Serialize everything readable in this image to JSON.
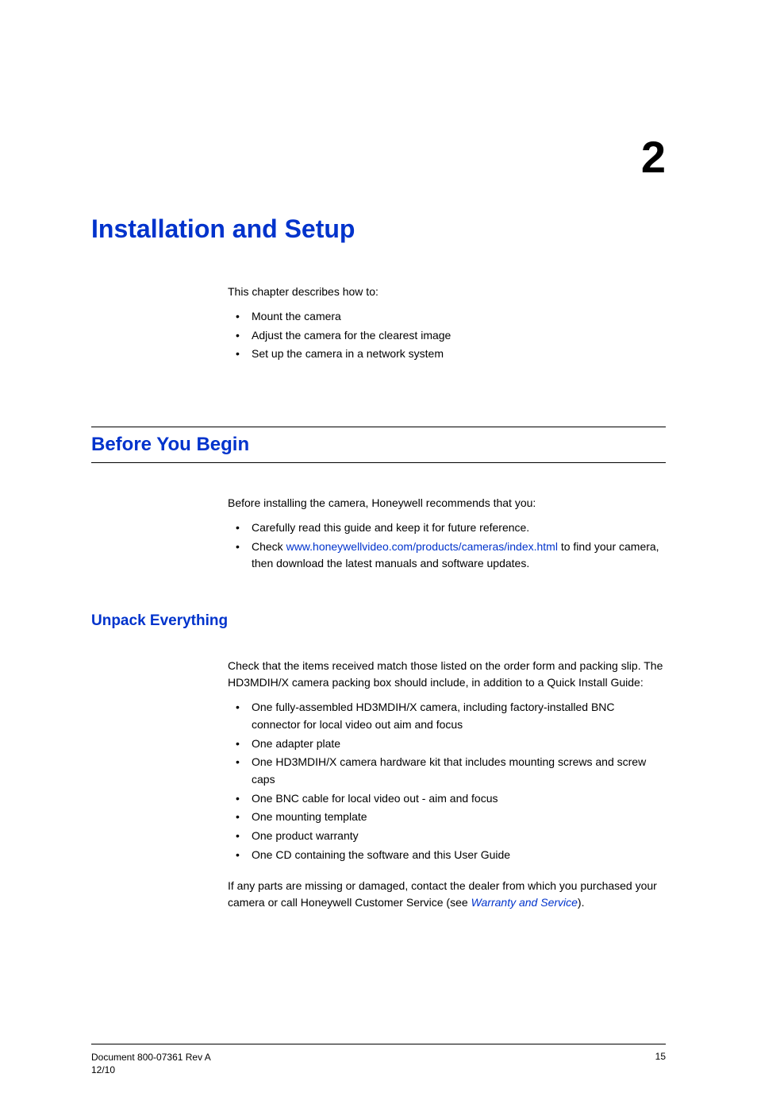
{
  "chapter": {
    "number": "2",
    "title": "Installation and Setup"
  },
  "intro": {
    "lead": "This chapter describes how to:",
    "bullets": [
      "Mount the camera",
      "Adjust the camera for the clearest image",
      "Set up the camera in a network system"
    ]
  },
  "section1": {
    "heading": "Before You Begin",
    "lead": "Before installing the camera, Honeywell recommends that you:",
    "bullets": {
      "b0": "Carefully read this guide and keep it for future reference.",
      "b1_pre": "Check ",
      "b1_link": "www.honeywellvideo.com/products/cameras/index.html",
      "b1_post": " to find your camera, then download the latest manuals and software updates."
    }
  },
  "section2": {
    "heading": "Unpack Everything",
    "lead": "Check that the items received match those listed on the order form and packing slip. The HD3MDIH/X camera packing box should include, in addition to a Quick Install Guide:",
    "bullets": [
      "One fully-assembled HD3MDIH/X camera, including factory-installed BNC connector for local video out aim and focus",
      "One adapter plate",
      "One HD3MDIH/X camera hardware kit that includes mounting screws and screw caps",
      "One BNC cable for local video out - aim and focus",
      "One mounting template",
      "One product warranty",
      "One CD containing the software and this User Guide"
    ],
    "trail_pre": "If any parts are missing or damaged, contact the dealer from which you purchased your camera or call Honeywell Customer Service (see ",
    "trail_link": "Warranty and Service",
    "trail_post": ")."
  },
  "footer": {
    "doc": "Document 800-07361 Rev A",
    "date": "12/10",
    "page": "15"
  }
}
